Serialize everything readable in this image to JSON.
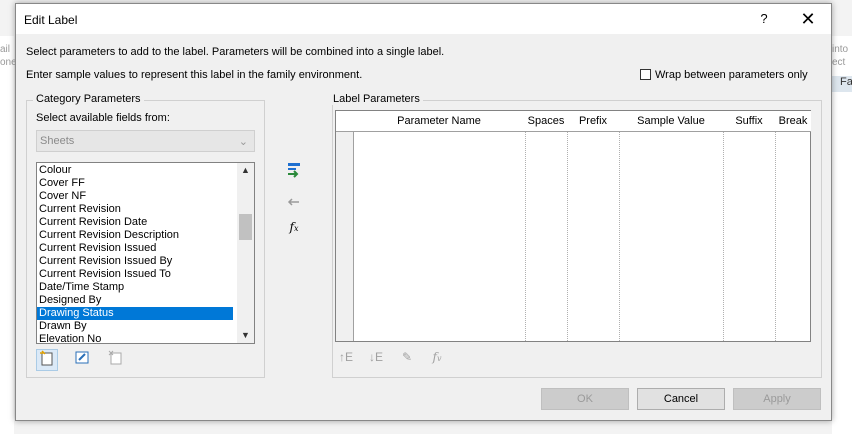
{
  "background": {
    "left_frag": [
      "ail",
      "one"
    ],
    "right_frag": [
      "into",
      "ect"
    ],
    "right_tab": "Fa"
  },
  "dialog": {
    "title": "Edit Label",
    "help_label": "?",
    "close_label": "✕",
    "instruction1": "Select parameters to add to the label.  Parameters will be combined into a single label.",
    "instruction2": "Enter sample values to represent this label in the family environment.",
    "wrap_label": "Wrap between parameters only"
  },
  "category": {
    "group_label": "Category Parameters",
    "select_label": "Select available fields from:",
    "combo_value": "Sheets",
    "items": [
      "Colour",
      "Cover FF",
      "Cover NF",
      "Current Revision",
      "Current Revision Date",
      "Current Revision Description",
      "Current Revision Issued",
      "Current Revision Issued By",
      "Current Revision Issued To",
      "Date/Time Stamp",
      "Designed By",
      "Drawing Status",
      "Drawn By",
      "Elevation No"
    ],
    "selected_index": 11
  },
  "label_params": {
    "group_label": "Label Parameters",
    "columns": [
      "Parameter Name",
      "Spaces",
      "Prefix",
      "Sample Value",
      "Suffix",
      "Break"
    ]
  },
  "buttons": {
    "ok": "OK",
    "cancel": "Cancel",
    "apply": "Apply"
  },
  "colors": {
    "selection": "#0078d7",
    "add_arrow": "#2a8a3a",
    "add_arrow_blue": "#1e6fd0"
  }
}
